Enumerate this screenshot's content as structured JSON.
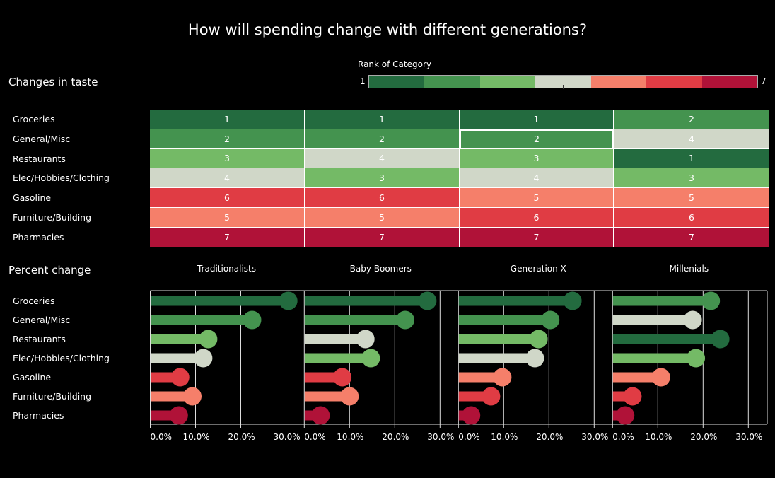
{
  "title": "How will spending change with different generations?",
  "sections": {
    "heatmap_title": "Changes in taste",
    "lollipop_title": "Percent change"
  },
  "legend": {
    "title": "Rank of Category",
    "min_label": "1",
    "max_label": "7",
    "colors": [
      "#236b3f",
      "#44934f",
      "#74ba66",
      "#d0d7c8",
      "#f57f6a",
      "#e03c44",
      "#b01238"
    ]
  },
  "chart_data": [
    {
      "type": "heatmap",
      "title": "Changes in taste",
      "legend_title": "Rank of Category",
      "rows": [
        "Groceries",
        "General/Misc",
        "Restaurants",
        "Elec/Hobbies/Clothing",
        "Gasoline",
        "Furniture/Building",
        "Pharmacies"
      ],
      "columns": [
        "Traditionalists",
        "Baby Boomers",
        "Generation X",
        "Millenials"
      ],
      "values": [
        [
          1,
          1,
          1,
          2
        ],
        [
          2,
          2,
          2,
          4
        ],
        [
          3,
          4,
          3,
          1
        ],
        [
          4,
          3,
          4,
          3
        ],
        [
          6,
          6,
          5,
          5
        ],
        [
          5,
          5,
          6,
          6
        ],
        [
          7,
          7,
          7,
          7
        ]
      ],
      "color_range": [
        1,
        7
      ],
      "highlighted_cell": {
        "row": "General/Misc",
        "column": "Generation X"
      }
    },
    {
      "type": "bar",
      "subtype": "lollipop",
      "title": "Percent change",
      "categories": [
        "Groceries",
        "General/Misc",
        "Restaurants",
        "Elec/Hobbies/Clothing",
        "Gasoline",
        "Furniture/Building",
        "Pharmacies"
      ],
      "series": [
        {
          "name": "Traditionalists",
          "values": [
            30.5,
            22.5,
            12.8,
            11.7,
            6.6,
            9.3,
            6.3
          ],
          "ranks": [
            1,
            2,
            3,
            4,
            6,
            5,
            7
          ]
        },
        {
          "name": "Baby Boomers",
          "values": [
            27.2,
            22.3,
            13.5,
            14.7,
            8.4,
            10.0,
            3.6
          ],
          "ranks": [
            1,
            2,
            4,
            3,
            6,
            5,
            7
          ]
        },
        {
          "name": "Generation X",
          "values": [
            25.2,
            20.3,
            17.7,
            16.9,
            9.7,
            7.2,
            2.8
          ],
          "ranks": [
            1,
            2,
            3,
            4,
            5,
            6,
            7
          ]
        },
        {
          "name": "Millenials",
          "values": [
            21.7,
            17.7,
            23.8,
            18.4,
            10.7,
            4.4,
            2.8
          ],
          "ranks": [
            2,
            4,
            1,
            3,
            5,
            6,
            7
          ]
        }
      ],
      "xlabel": "",
      "ylabel": "",
      "xlim": [
        0,
        34
      ],
      "xticks": [
        "0.0%",
        "10.0%",
        "20.0%",
        "30.0%"
      ],
      "xtick_values": [
        0,
        10,
        20,
        30
      ],
      "grid": true
    }
  ]
}
